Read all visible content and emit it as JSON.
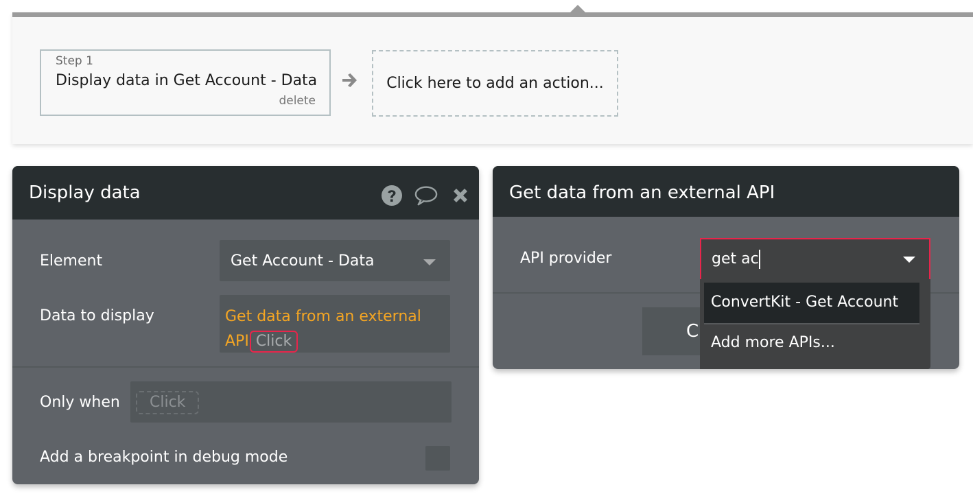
{
  "workflow": {
    "step": {
      "label": "Step 1",
      "title": "Display data in Get Account - Data",
      "delete_label": "delete"
    },
    "add_action_label": "Click here to add an action..."
  },
  "display_panel": {
    "title": "Display data",
    "icons": [
      "help-icon",
      "comment-icon",
      "close-icon"
    ],
    "element": {
      "label": "Element",
      "value": "Get Account - Data"
    },
    "data_to_display": {
      "label": "Data to display",
      "expression": "Get data from an external API",
      "click_chip": "Click"
    },
    "only_when": {
      "label": "Only when",
      "click_chip": "Click"
    },
    "breakpoint": {
      "label": "Add a breakpoint in debug mode",
      "checked": false
    }
  },
  "api_panel": {
    "title": "Get data from an external API",
    "api_provider": {
      "label": "API provider",
      "input_value": "get ac",
      "options": [
        "ConvertKit - Get Account",
        "Add more APIs..."
      ],
      "highlighted_option": "ConvertKit - Get Account"
    },
    "hidden_button_label": "C"
  },
  "colors": {
    "panel_header": "#282e30",
    "panel_body": "#5f6368",
    "field_bg": "#52575a",
    "expression_text": "#f5a623",
    "focus_border": "#e8254b"
  }
}
